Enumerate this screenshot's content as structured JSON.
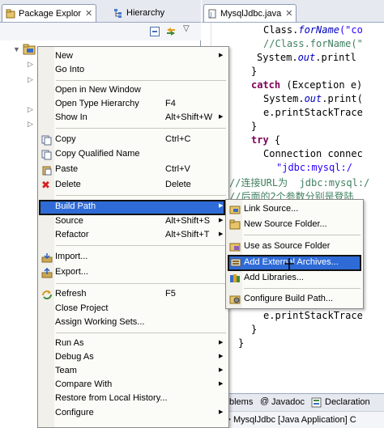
{
  "left_tabs": [
    {
      "label": "Package Explor",
      "close": "✕"
    },
    {
      "label": "Hierarchy"
    }
  ],
  "editor_tab": {
    "label": "MysqlJdbc.java",
    "close": "✕"
  },
  "code": {
    "l1_a": "Class.",
    "l1_b": "forName",
    "l1_c": "(\"co",
    "l2": "//Class.forName(\"",
    "l3_a": "System.",
    "l3_b": "out",
    "l3_c": ".printl",
    "l4": "}",
    "l5_kw": "catch",
    "l5_rest": " (Exception e)",
    "l6_a": "System.",
    "l6_b": "out",
    "l6_c": ".print(",
    "l7": "e.printStackTrace",
    "l8": "}",
    "l9_kw": "try",
    "l9_rest": " {",
    "l10": "Connection connec",
    "l11": "\"jdbc:mysql:/",
    "l12": "//连接URL为  jdbc:mysql:/",
    "l13": "//后面的2个参数分别是登陆",
    "l14": "e.printStackTrace",
    "l15": "}",
    "l16": "}"
  },
  "bottom_tabs": [
    "blems",
    "Javadoc",
    "Declaration"
  ],
  "status_text": "nated> MysqlJdbc [Java Application] C",
  "context_menu": {
    "items": [
      {
        "label": "New",
        "shortcut": "",
        "submenu": true
      },
      {
        "label": "Go Into",
        "shortcut": "",
        "submenu": false
      },
      {
        "sep": true
      },
      {
        "label": "Open in New Window",
        "shortcut": "",
        "submenu": false
      },
      {
        "label": "Open Type Hierarchy",
        "shortcut": "F4",
        "submenu": false
      },
      {
        "label": "Show In",
        "shortcut": "Alt+Shift+W",
        "submenu": true
      },
      {
        "sep": true
      },
      {
        "label": "Copy",
        "shortcut": "Ctrl+C",
        "icon": "copy-icon"
      },
      {
        "label": "Copy Qualified Name",
        "shortcut": "",
        "icon": "copy-qualified-icon"
      },
      {
        "label": "Paste",
        "shortcut": "Ctrl+V",
        "icon": "paste-icon"
      },
      {
        "label": "Delete",
        "shortcut": "Delete",
        "icon": "delete-icon"
      },
      {
        "sep": true
      },
      {
        "label": "Build Path",
        "shortcut": "",
        "submenu": true,
        "highlighted": true
      },
      {
        "label": "Source",
        "shortcut": "Alt+Shift+S",
        "submenu": true
      },
      {
        "label": "Refactor",
        "shortcut": "Alt+Shift+T",
        "submenu": true
      },
      {
        "sep": true
      },
      {
        "label": "Import...",
        "shortcut": "",
        "icon": "import-icon"
      },
      {
        "label": "Export...",
        "shortcut": "",
        "icon": "export-icon"
      },
      {
        "sep": true
      },
      {
        "label": "Refresh",
        "shortcut": "F5",
        "icon": "refresh-icon"
      },
      {
        "label": "Close Project",
        "shortcut": ""
      },
      {
        "label": "Assign Working Sets...",
        "shortcut": ""
      },
      {
        "sep": true
      },
      {
        "label": "Run As",
        "shortcut": "",
        "submenu": true
      },
      {
        "label": "Debug As",
        "shortcut": "",
        "submenu": true
      },
      {
        "label": "Team",
        "shortcut": "",
        "submenu": true
      },
      {
        "label": "Compare With",
        "shortcut": "",
        "submenu": true
      },
      {
        "label": "Restore from Local History...",
        "shortcut": ""
      },
      {
        "label": "Configure",
        "shortcut": "",
        "submenu": true
      }
    ]
  },
  "build_path_menu": {
    "items": [
      {
        "label": "Link Source...",
        "icon": "link-source-icon"
      },
      {
        "label": "New Source Folder...",
        "icon": "new-source-folder-icon"
      },
      {
        "sep": true
      },
      {
        "label": "Use as Source Folder",
        "icon": "use-source-folder-icon"
      },
      {
        "label": "Add External Archives...",
        "icon": "add-external-archives-icon",
        "highlighted": true
      },
      {
        "label": "Add Libraries...",
        "icon": "add-libraries-icon"
      },
      {
        "sep": true
      },
      {
        "label": "Configure Build Path...",
        "icon": "configure-build-path-icon"
      }
    ]
  },
  "colors": {
    "highlight": "#2f6bd7",
    "keyword": "#7f0055",
    "string": "#2a00ff",
    "comment": "#3f7f5f"
  }
}
